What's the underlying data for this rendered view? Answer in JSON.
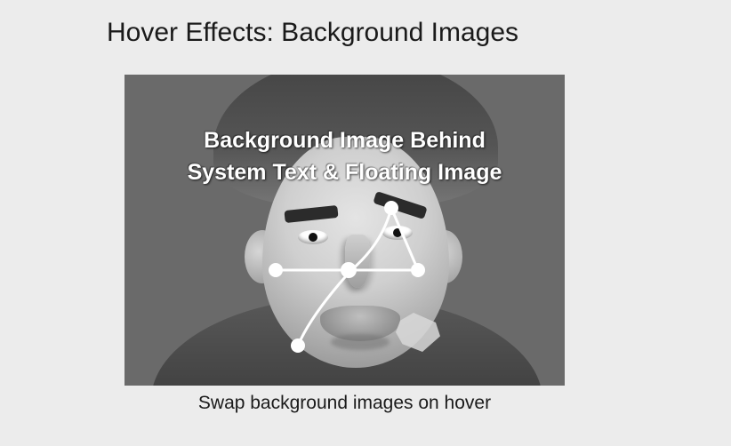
{
  "title": "Hover Effects: Background Images",
  "card": {
    "overlay_line1": "Background Image Behind",
    "overlay_line2": "System Text & Floating Image"
  },
  "caption": "Swap background images on hover"
}
